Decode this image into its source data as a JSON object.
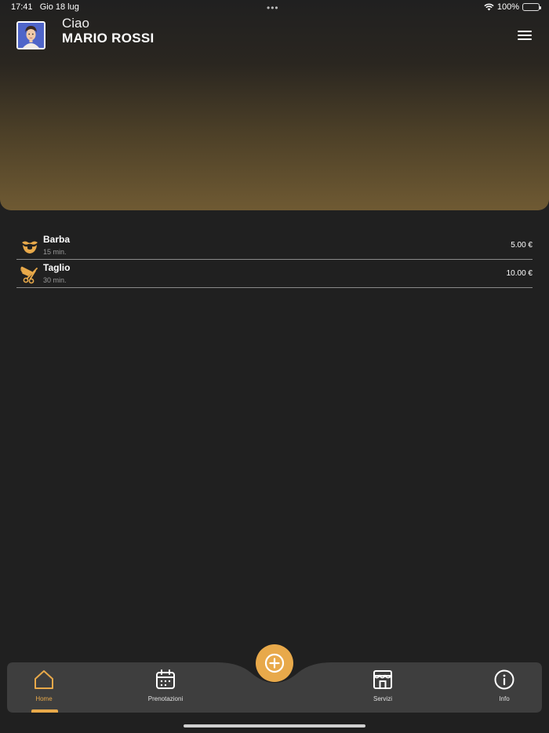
{
  "status_bar": {
    "time": "17:41",
    "date": "Gio 18 lug",
    "dots": "•••",
    "battery_percent": "100%"
  },
  "header": {
    "greeting": "Ciao",
    "user_name": "MARIO ROSSI",
    "menu_icon": "hamburger-menu-icon",
    "avatar_icon": "user-avatar"
  },
  "services": [
    {
      "name": "Barba",
      "duration": "15 min.",
      "price": "5.00 €",
      "icon": "beard-icon"
    },
    {
      "name": "Taglio",
      "duration": "30 min.",
      "price": "10.00 €",
      "icon": "scissors-comb-icon"
    }
  ],
  "nav": {
    "items": [
      {
        "label": "Home",
        "icon": "home-icon",
        "active": true
      },
      {
        "label": "Prenotazioni",
        "icon": "calendar-icon",
        "active": false
      },
      {
        "label": "Servizi",
        "icon": "shop-icon",
        "active": false
      },
      {
        "label": "Info",
        "icon": "info-icon",
        "active": false
      }
    ],
    "fab_icon": "plus-circle-icon"
  },
  "colors": {
    "accent": "#e8a94a",
    "background": "#202020",
    "nav_background": "#3e3e3e",
    "divider": "#8a8a8a"
  }
}
